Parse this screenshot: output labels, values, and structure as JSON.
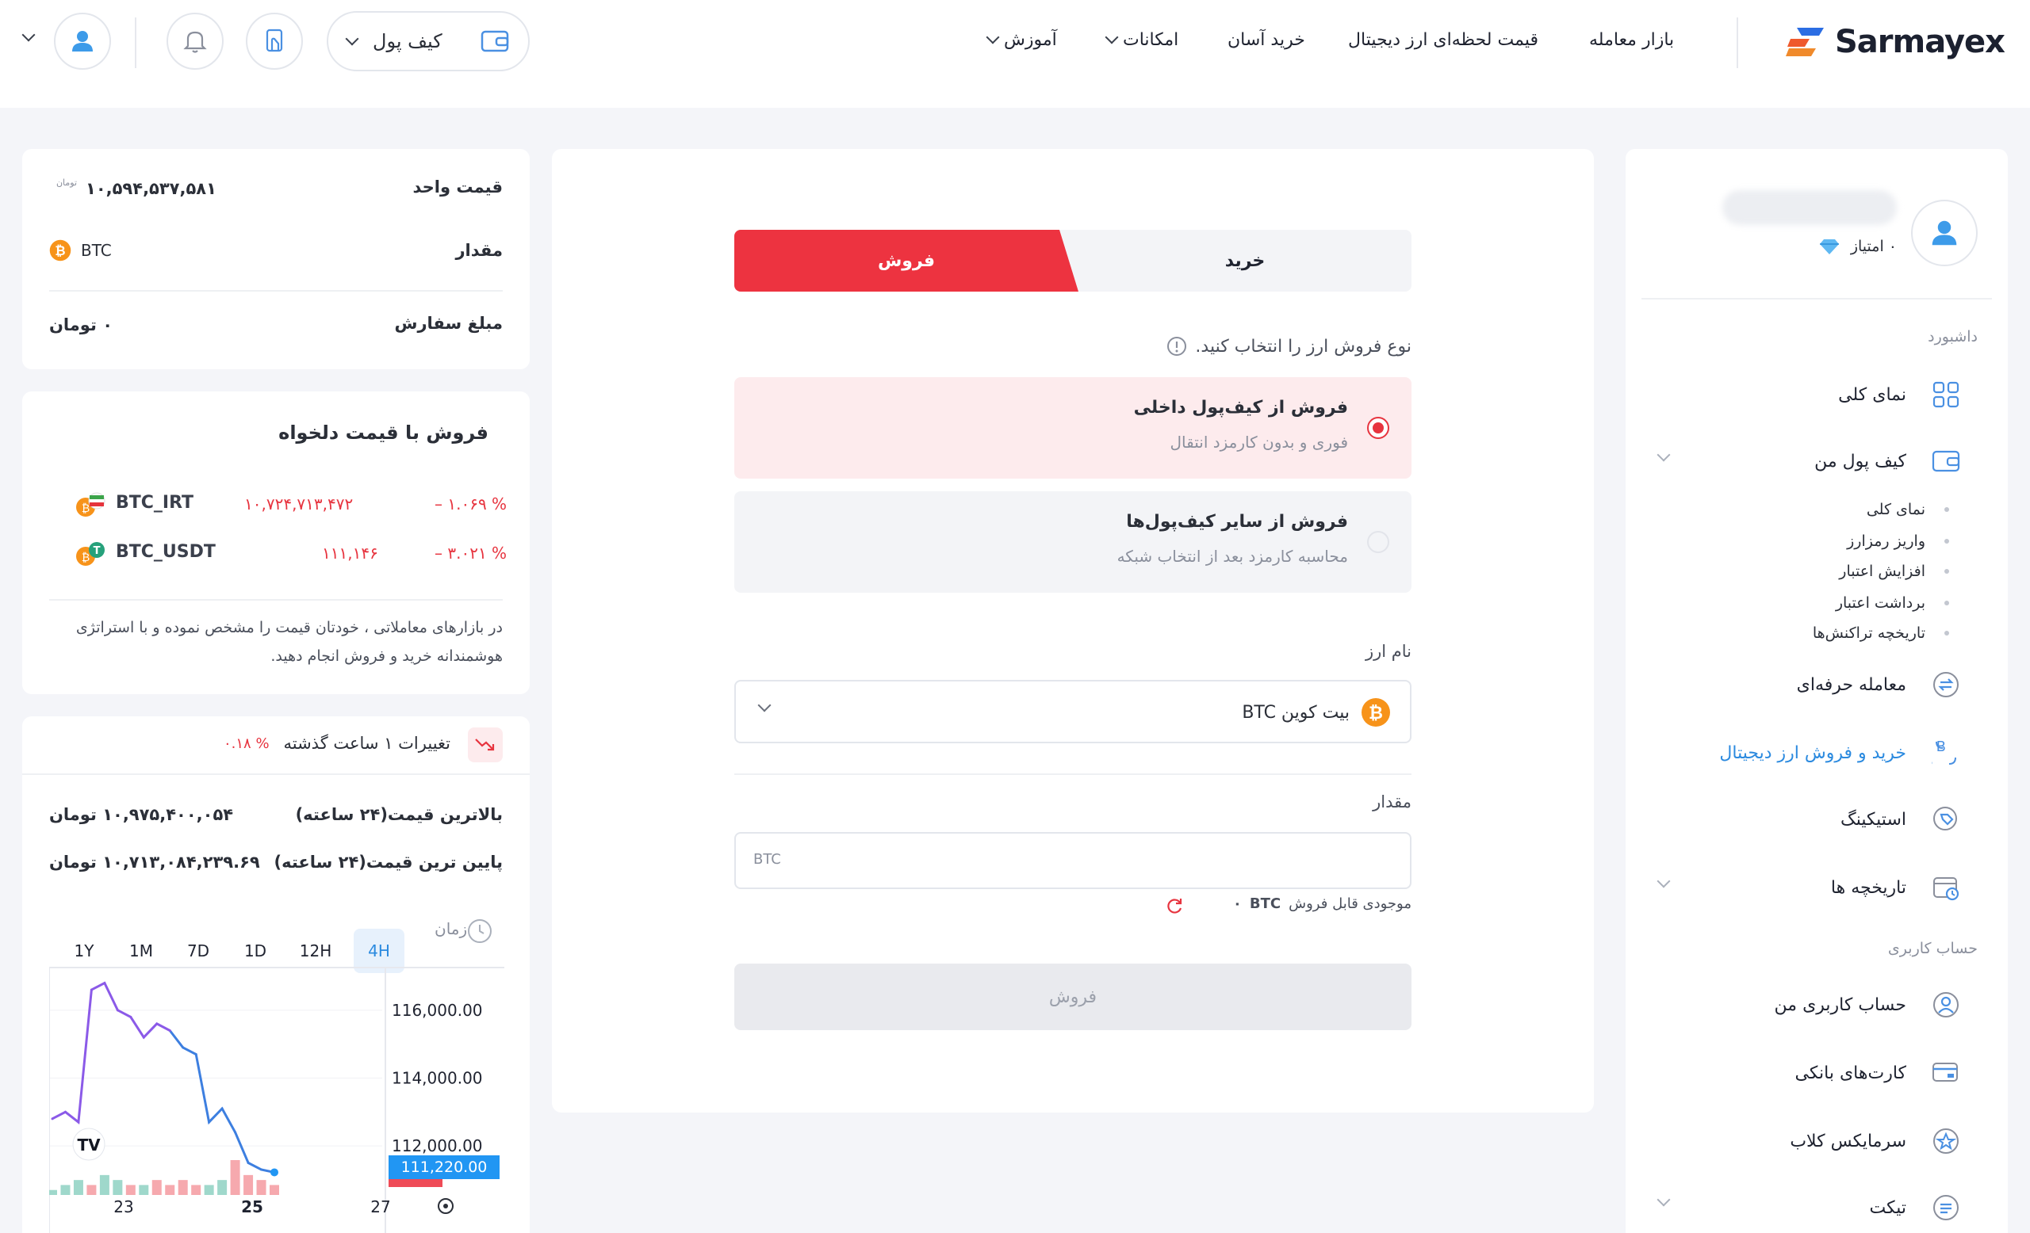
{
  "header": {
    "logo_text": "Sarmayex",
    "nav": [
      "بازار معامله",
      "قیمت لحظه‌ای ارز دیجیتال",
      "خرید آسان",
      "امکانات",
      "آموزش"
    ],
    "wallet_label": "کیف پول"
  },
  "sidebar": {
    "points": "۰ امتیاز",
    "section_dashboard": "داشبورد",
    "items": {
      "overview": "نمای کلی",
      "my_wallet": "کیف پول من",
      "pro_trade": "معامله حرفه‌ای",
      "buy_sell": "خرید و فروش ارز دیجیتال",
      "staking": "استیکینگ",
      "history": "تاریخچه ها"
    },
    "wallet_sub": [
      "نمای کلی",
      "واریز رمزارز",
      "افزایش اعتبار",
      "برداشت اعتبار",
      "تاریخچه تراکنش‌ها"
    ],
    "section_account": "حساب کاربری",
    "account_items": {
      "my_account": "حساب کاربری من",
      "bank_cards": "کارت‌های بانکی",
      "club": "سرمایکس کلاب",
      "ticket": "تیکت"
    }
  },
  "trade": {
    "tab_buy": "خرید",
    "tab_sell": "فروش",
    "sell_type_prompt": "نوع فروش ارز را انتخاب کنید.",
    "option_internal_title": "فروش از کیف‌پول داخلی",
    "option_internal_sub": "فوری و بدون کارمزد انتقال",
    "option_external_title": "فروش از سایر کیف‌پول‌ها",
    "option_external_sub": "محاسبه کارمزد بعد از انتخاب شبکه",
    "currency_label": "نام ارز",
    "currency_value": "بیت کوین BTC",
    "amount_label": "مقدار",
    "amount_placeholder": "BTC",
    "balance_label": "موجودی قابل فروش",
    "balance_unit": "BTC",
    "balance_value": "۰",
    "submit_label": "فروش"
  },
  "summary": {
    "unit_price_label": "قیمت واحد",
    "unit_price_value": "۱۰,۵۹۴,۵۳۷,۵۸۱",
    "unit_price_currency": "تومان",
    "amount_label": "مقدار",
    "amount_value": "BTC",
    "order_total_label": "مبلغ سفارش",
    "order_total_value": "۰ تومان"
  },
  "custom_price": {
    "title": "فروش با قیمت دلخواه",
    "markets": [
      {
        "symbol": "BTC_IRT",
        "price": "۱۰,۷۲۴,۷۱۳,۴۷۲",
        "change": "– ۱.۰۶۹ %"
      },
      {
        "symbol": "BTC_USDT",
        "price": "۱۱۱,۱۴۶",
        "change": "– ۳.۰۲۱ %"
      }
    ],
    "note": "در بازارهای معاملاتی ، خودتان قیمت را مشخص نموده و با استراتژی هوشمندانه خرید و فروش انجام دهید."
  },
  "stats": {
    "change_label": "تغییرات ۱ ساعت گذشته",
    "change_value": "۰.۱۸ %",
    "high_label": "بالاترین قیمت(۲۴ ساعته)",
    "high_value": "۱۰,۹۷۵,۴۰۰,۰۵۴ تومان",
    "low_label": "پایین ترین قیمت(۲۴ ساعته)",
    "low_value": "۱۰,۷۱۳,۰۸۴,۲۳۹.۶۹ تومان",
    "time_label": "زمان",
    "timeframes": [
      "4H",
      "12H",
      "1D",
      "7D",
      "1M",
      "1Y"
    ],
    "active_timeframe": "4H"
  },
  "chart_data": {
    "type": "line",
    "y_ticks": [
      "116,000.00",
      "114,000.00",
      "112,000.00"
    ],
    "x_ticks": [
      "23",
      "25",
      "27"
    ],
    "current_price_label": "111,220.00",
    "ylim": [
      110600,
      117000
    ],
    "x": [
      0,
      1,
      2,
      3,
      4,
      5,
      6,
      7,
      8,
      9,
      10,
      11,
      12,
      13,
      14,
      15,
      16,
      17
    ],
    "values": [
      112800,
      113000,
      112700,
      116600,
      116800,
      116000,
      115800,
      115200,
      115600,
      115400,
      114900,
      114700,
      112700,
      113100,
      112400,
      111500,
      111300,
      111220
    ],
    "line_colors": [
      "#3d7fe0",
      "#8b5ae8"
    ],
    "volume": [
      1,
      2,
      3,
      2,
      4,
      3,
      2,
      2,
      3,
      2,
      3,
      2,
      2,
      3,
      7,
      4,
      3,
      2
    ],
    "volume_up": [
      true,
      true,
      true,
      false,
      true,
      true,
      false,
      true,
      false,
      false,
      false,
      false,
      true,
      true,
      false,
      false,
      false,
      false
    ]
  }
}
